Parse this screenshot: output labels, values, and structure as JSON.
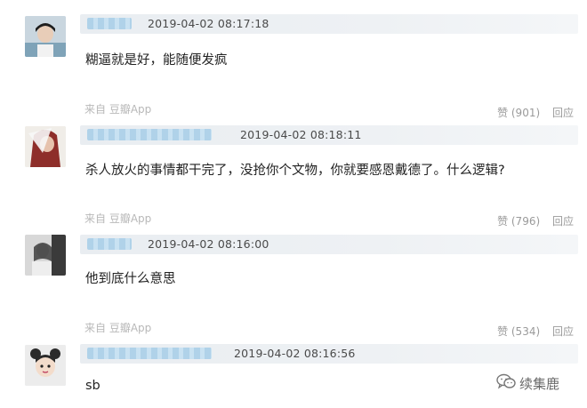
{
  "comments": [
    {
      "timestamp": "2019-04-02 08:17:18",
      "text": "糊逼就是好，能随便发疯",
      "source": "来自 豆瓣App",
      "like": "赞 (901)",
      "reply": "回应"
    },
    {
      "timestamp": "2019-04-02 08:18:11",
      "text": "杀人放火的事情都干完了，没抢你个文物，你就要感恩戴德了。什么逻辑?",
      "source": "来自 豆瓣App",
      "like": "赞 (796)",
      "reply": "回应"
    },
    {
      "timestamp": "2019-04-02 08:16:00",
      "text": "他到底什么意思",
      "source": "来自 豆瓣App",
      "like": "赞 (534)",
      "reply": "回应"
    },
    {
      "timestamp": "2019-04-02 08:16:56",
      "text": "sb"
    }
  ],
  "watermark": {
    "text": "续集鹿"
  },
  "colors": {
    "header_bg": "#eef1f4",
    "username_blur": "#a9cfe8",
    "meta_gray": "#9a9a9a"
  },
  "icons": {
    "watermark": "wechat-icon"
  }
}
